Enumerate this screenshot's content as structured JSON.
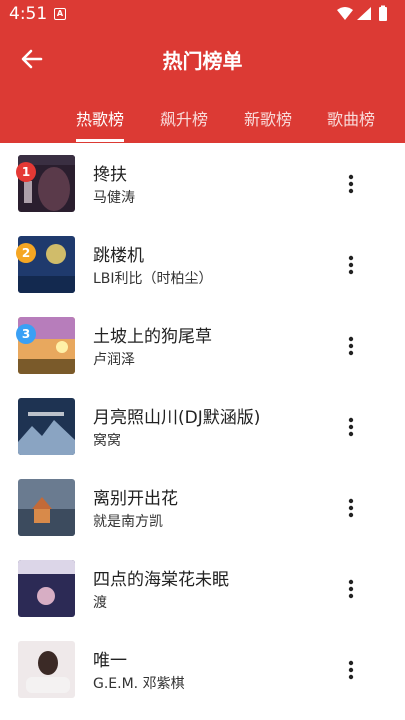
{
  "status": {
    "time": "4:51",
    "notify_icon": "A"
  },
  "header": {
    "title": "热门榜单"
  },
  "tabs": [
    {
      "label": "热歌榜",
      "active": true
    },
    {
      "label": "飙升榜",
      "active": false
    },
    {
      "label": "新歌榜",
      "active": false
    },
    {
      "label": "歌曲榜",
      "active": false
    }
  ],
  "songs": [
    {
      "title": "搀扶",
      "artist": "马健涛",
      "rank": "1",
      "rank_color": "#e53935",
      "cover_color": "#2a1e2e"
    },
    {
      "title": "跳楼机",
      "artist": "LBI利比（时柏尘）",
      "rank": "2",
      "rank_color": "#f5a623",
      "cover_color": "#1f3a6d"
    },
    {
      "title": "土坡上的狗尾草",
      "artist": "卢润泽",
      "rank": "3",
      "rank_color": "#3aa0f5",
      "cover_color": "#c98f4a"
    },
    {
      "title": "月亮照山川(DJ默涵版)",
      "artist": "窝窝",
      "cover_color": "#1e3352"
    },
    {
      "title": "离别开出花",
      "artist": "就是南方凯",
      "cover_color": "#3c4b5e"
    },
    {
      "title": "四点的海棠花未眠",
      "artist": "渡",
      "cover_color": "#2c2a55"
    },
    {
      "title": "唯一",
      "artist": "G.E.M. 邓紫棋",
      "cover_color": "#e9e4e4"
    }
  ],
  "colors": {
    "accent": "#dc3a34"
  }
}
